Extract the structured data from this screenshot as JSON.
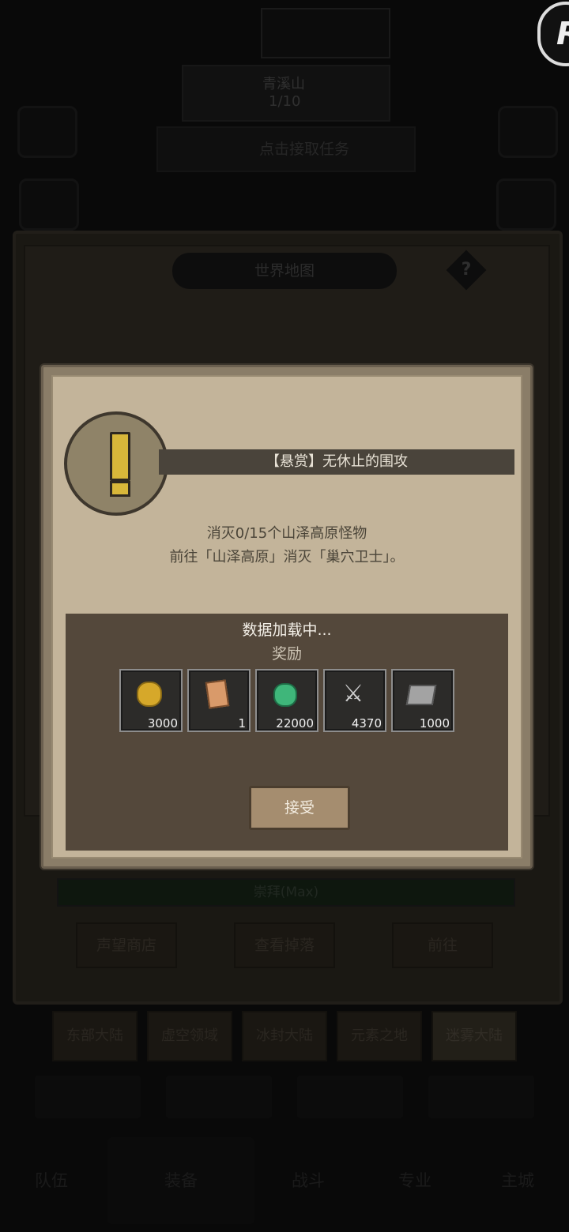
{
  "background": {
    "quest_tracker": {
      "name": "青溪山",
      "progress": "1/10"
    },
    "claim_task": "点击接取任务",
    "world_map_title": "世界地图",
    "help_symbol": "?",
    "worship_bar": "崇拜(Max)",
    "action_buttons": [
      "声望商店",
      "查看掉落",
      "前往"
    ],
    "region_tabs": [
      "东部大陆",
      "虚空领域",
      "冰封大陆",
      "元素之地",
      "迷雾大陆"
    ],
    "bottom_nav": [
      "队伍",
      "装备",
      "战斗",
      "专业",
      "主城"
    ],
    "corner_badge": "R"
  },
  "modal": {
    "title": "【悬赏】无休止的围攻",
    "objective": "消灭0/15个山泽高原怪物",
    "instruction": "前往「山泽高原」消灭「巢穴卫士」。",
    "loading_text": "数据加载中...",
    "reward_label": "奖励",
    "rewards": [
      {
        "icon": "gold-coin-icon",
        "count": "3000"
      },
      {
        "icon": "scroll-icon",
        "count": "1"
      },
      {
        "icon": "green-gem-icon",
        "count": "22000"
      },
      {
        "icon": "crossed-swords-icon",
        "count": "4370"
      },
      {
        "icon": "book-icon",
        "count": "1000"
      }
    ],
    "accept_label": "接受"
  }
}
